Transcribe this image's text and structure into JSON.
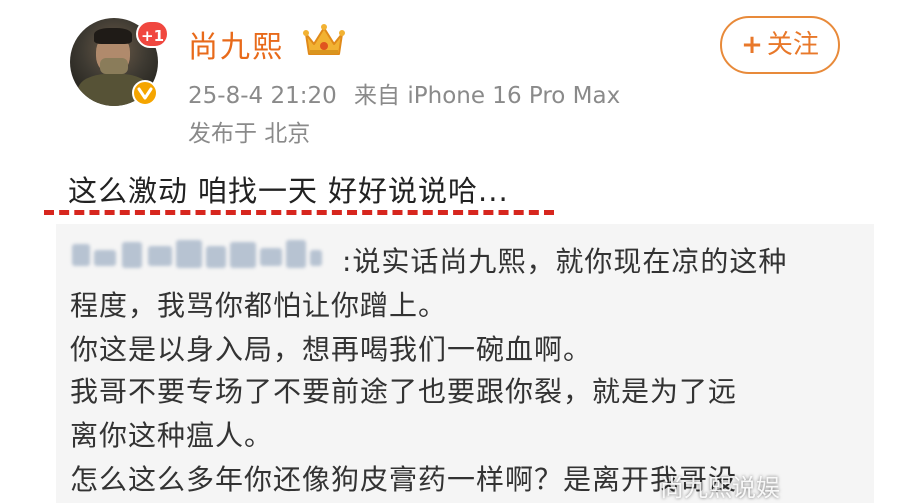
{
  "user": {
    "name": "尚九熙",
    "notification_count": "+1",
    "timestamp": "25-8-4 21:20",
    "source": "来自 iPhone 16 Pro Max",
    "location": "发布于 北京"
  },
  "follow": {
    "plus": "+",
    "label": "关注"
  },
  "post": {
    "text_parts": [
      "这么激动",
      "咱找一天",
      "好好说说哈..."
    ]
  },
  "repost": {
    "lines": [
      ":说实话尚九熙，就你现在凉的这种",
      "程度，我骂你都怕让你蹭上。",
      "你这是以身入局，想再喝我们一碗血啊。",
      "我哥不要专场了不要前途了也要跟你裂，就是为了远",
      "离你这种瘟人。",
      "怎么这么多年你还像狗皮膏药一样啊？是离开我哥没"
    ]
  },
  "colors": {
    "username": "#e86a1a",
    "follow_border": "#e88a3a",
    "underline": "#d7261e",
    "badge": "#f0473f",
    "verified": "#f5a500"
  },
  "icons": {
    "verified": "verified-v-icon",
    "crown": "crown-icon"
  },
  "watermark": "尚九熙说娱"
}
